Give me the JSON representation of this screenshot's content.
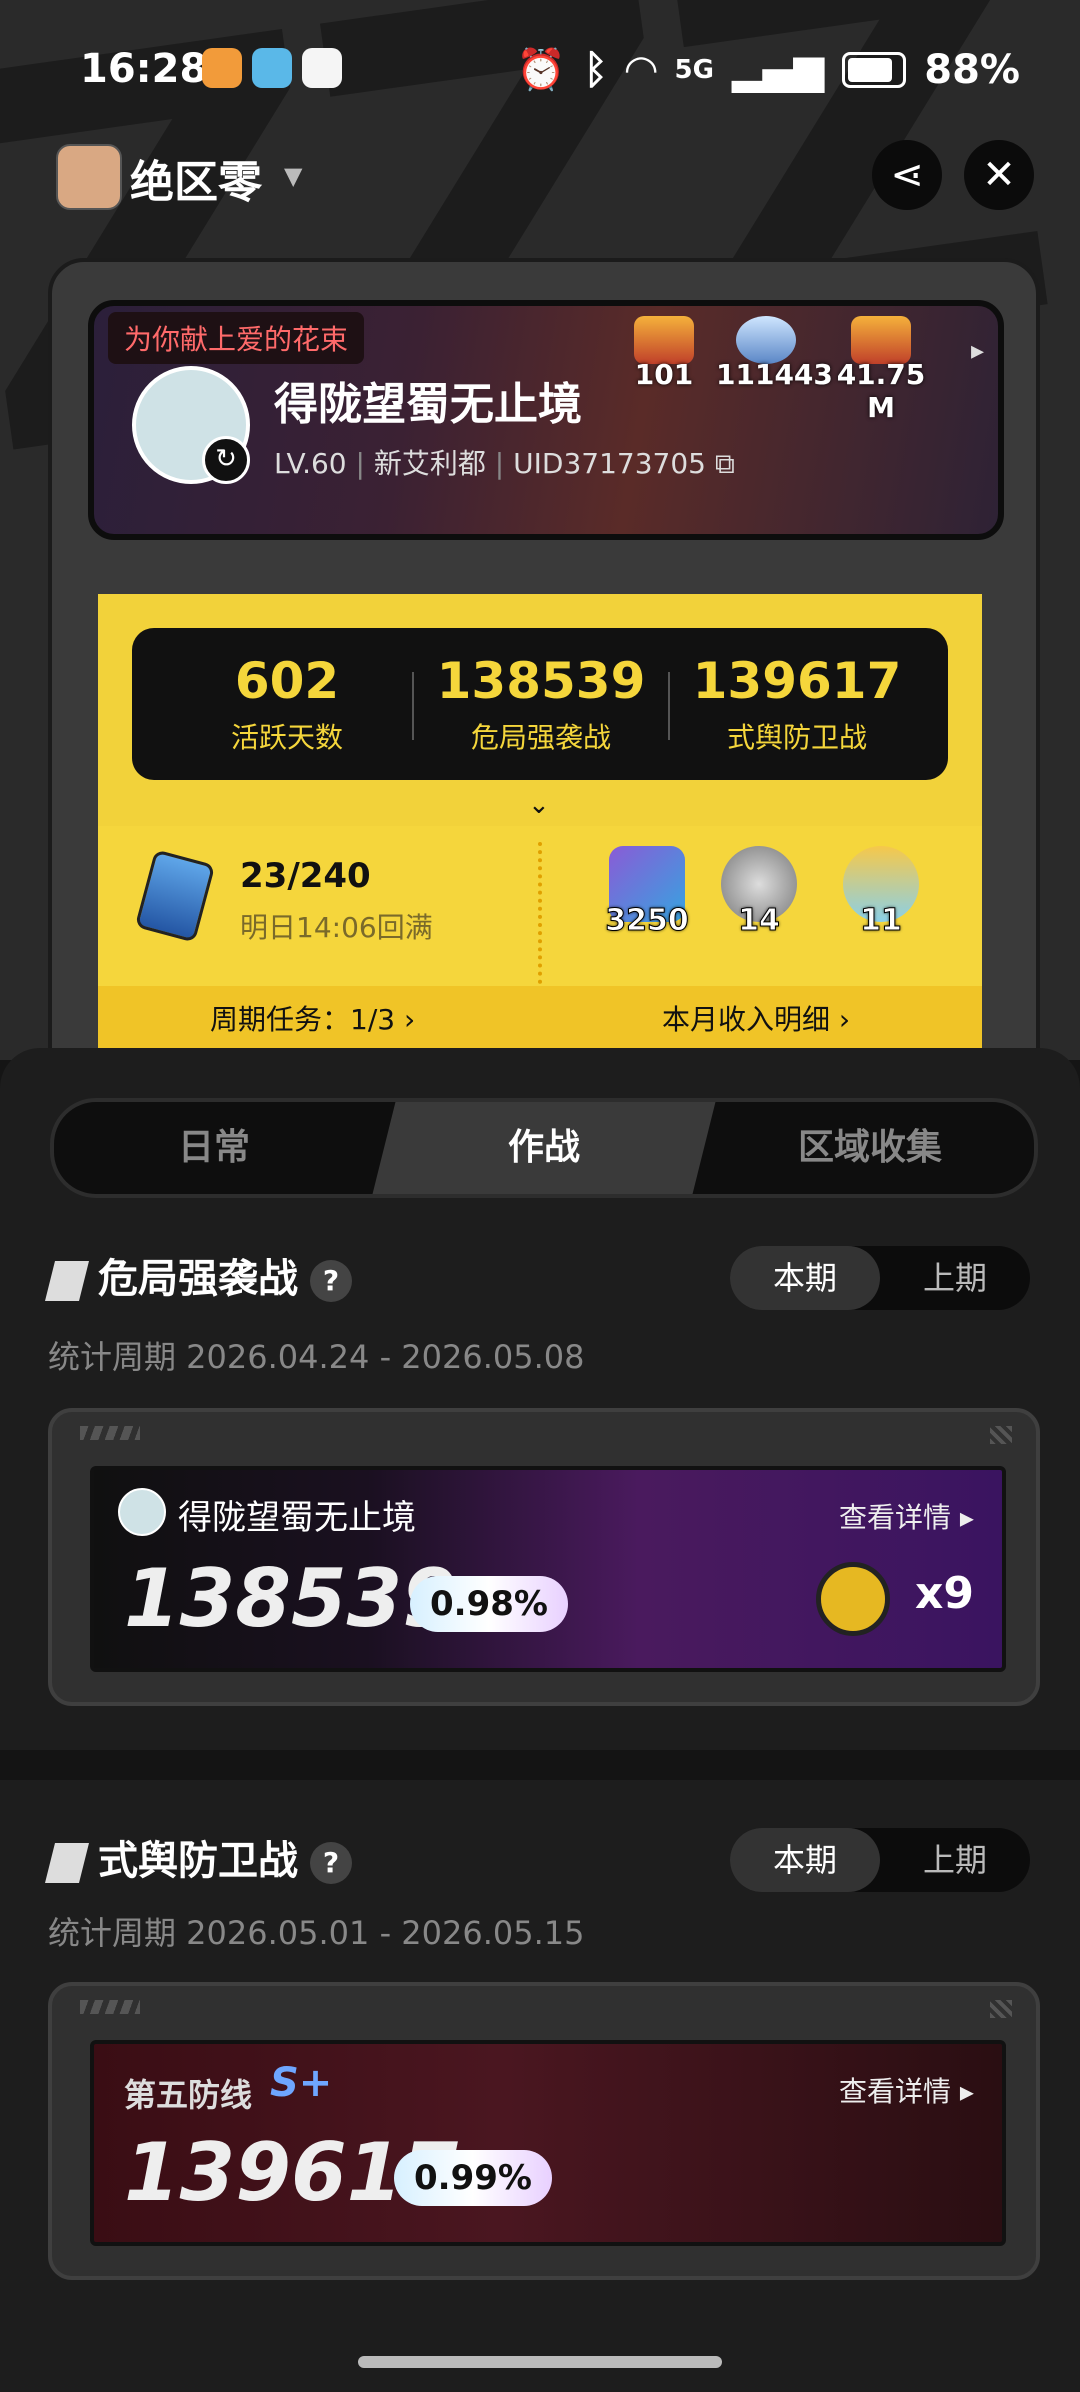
{
  "status_bar": {
    "time": "16:28",
    "network": "5G",
    "battery": "88%"
  },
  "header": {
    "app_name": "绝区零"
  },
  "profile": {
    "ribbon": "为你献上爱的花束",
    "name": "得陇望蜀无止境",
    "level": "LV.60",
    "server": "新艾利都",
    "uid": "UID37173705",
    "badges": [
      {
        "emblem": "LEGEND",
        "value": "101"
      },
      {
        "emblem": "Final",
        "value": "111443"
      },
      {
        "emblem": "LEGEND",
        "value": "41.75 M"
      }
    ]
  },
  "stats": [
    {
      "value": "602",
      "label": "活跃天数"
    },
    {
      "value": "138539",
      "label": "危局强袭战"
    },
    {
      "value": "139617",
      "label": "式舆防卫战"
    }
  ],
  "stamina": {
    "current": "23/240",
    "regen": "明日14:06回满"
  },
  "items": [
    {
      "icon": "film-icon",
      "count": "3250"
    },
    {
      "icon": "reel-icon",
      "count": "14"
    },
    {
      "icon": "bangboo-icon",
      "count": "11"
    }
  ],
  "links": {
    "weekly": "周期任务：1/3 ›",
    "income": "本月收入明细 ›"
  },
  "tabs": [
    "日常",
    "作战",
    "区域收集"
  ],
  "section1": {
    "title": "危局强袭战",
    "toggle_current": "本期",
    "toggle_prev": "上期",
    "period": "统计周期 2026.04.24 - 2026.05.08",
    "card": {
      "name": "得陇望蜀无止境",
      "details": "查看详情 ▸",
      "score": "138539",
      "percent": "0.98%",
      "reward": "x9"
    }
  },
  "section2": {
    "title": "式舆防卫战",
    "toggle_current": "本期",
    "toggle_prev": "上期",
    "period": "统计周期 2026.05.01 - 2026.05.15",
    "card": {
      "stage": "第五防线",
      "rank": "S+",
      "details": "查看详情 ▸",
      "score": "139617",
      "percent": "0.99%"
    }
  }
}
